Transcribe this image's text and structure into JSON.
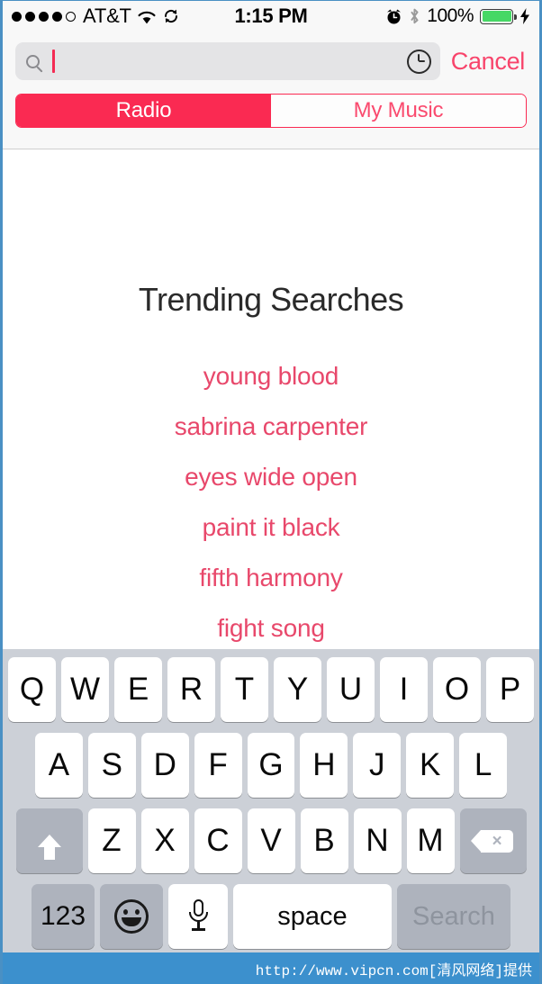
{
  "status_bar": {
    "signal_dots_filled": 4,
    "signal_dots_total": 5,
    "carrier": "AT&T",
    "wifi_icon": "wifi-icon",
    "sync_icon": "sync-icon",
    "time": "1:15 PM",
    "alarm_icon": "alarm-clock-icon",
    "bluetooth_icon": "bluetooth-icon",
    "battery_percent": "100%",
    "battery_color": "#46d865",
    "charging_icon": "lightning-bolt-icon"
  },
  "search": {
    "magnifier_icon": "search-icon",
    "value": "",
    "placeholder": "",
    "history_icon": "clock-history-icon",
    "cancel_label": "Cancel",
    "caret_color": "#f42b53"
  },
  "segmented_control": {
    "accent_color": "#fa2a52",
    "selected_index": 0,
    "segments": [
      {
        "label": "Radio"
      },
      {
        "label": "My Music"
      }
    ]
  },
  "content": {
    "title": "Trending Searches",
    "title_color": "#2a2a2a",
    "item_color": "#e8486b",
    "trending": [
      {
        "label": "young blood"
      },
      {
        "label": "sabrina carpenter"
      },
      {
        "label": "eyes wide open"
      },
      {
        "label": "paint it black"
      },
      {
        "label": "fifth harmony"
      },
      {
        "label": "fight song"
      }
    ]
  },
  "keyboard": {
    "row1": [
      "Q",
      "W",
      "E",
      "R",
      "T",
      "Y",
      "U",
      "I",
      "O",
      "P"
    ],
    "row2": [
      "A",
      "S",
      "D",
      "F",
      "G",
      "H",
      "J",
      "K",
      "L"
    ],
    "row3": [
      "Z",
      "X",
      "C",
      "V",
      "B",
      "N",
      "M"
    ],
    "shift_icon": "shift-arrow-icon",
    "delete_icon": "delete-backspace-icon",
    "numbers_label": "123",
    "emoji_icon": "emoji-smiley-icon",
    "dictation_icon": "microphone-icon",
    "space_label": "space",
    "return_label": "Search"
  },
  "watermark": {
    "text": "http://www.vipcn.com[清风网络]提供"
  }
}
